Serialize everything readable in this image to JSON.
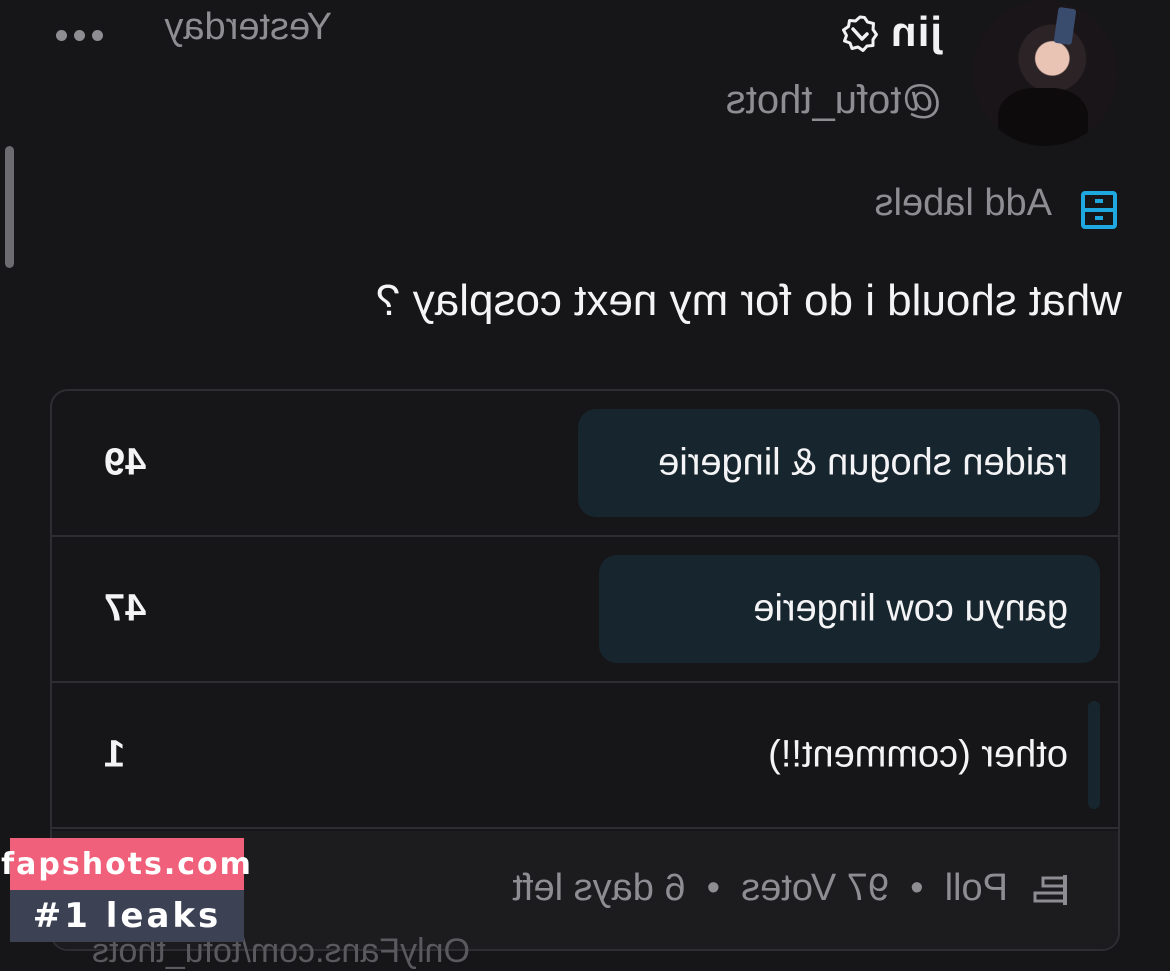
{
  "post": {
    "name": "jin",
    "handle": "@tofu_thots",
    "timestamp": "Yesterday",
    "labels_link": "Add labels",
    "text": "what should i do for my next cosplay ?"
  },
  "poll": {
    "options": [
      {
        "label": "raiden shogun & lingerie",
        "votes": "49",
        "share": 0.505
      },
      {
        "label": "ganyu cow lingerie",
        "votes": "47",
        "share": 0.485
      },
      {
        "label": "other (comment!!)",
        "votes": "1",
        "share": 0.01
      }
    ],
    "footer": {
      "type": "Poll",
      "votes": "97 Votes",
      "remaining": "6 days left",
      "separator": "•"
    }
  },
  "bottom_text": "OnlyFans.com/tofu_thots",
  "watermark": {
    "line1": "fapshots.com",
    "line2": "#1 leaks"
  },
  "colors": {
    "accent": "#1fa8e0",
    "background": "#161618",
    "poll_fill": "#17262e",
    "watermark_pink": "#f0607a"
  }
}
